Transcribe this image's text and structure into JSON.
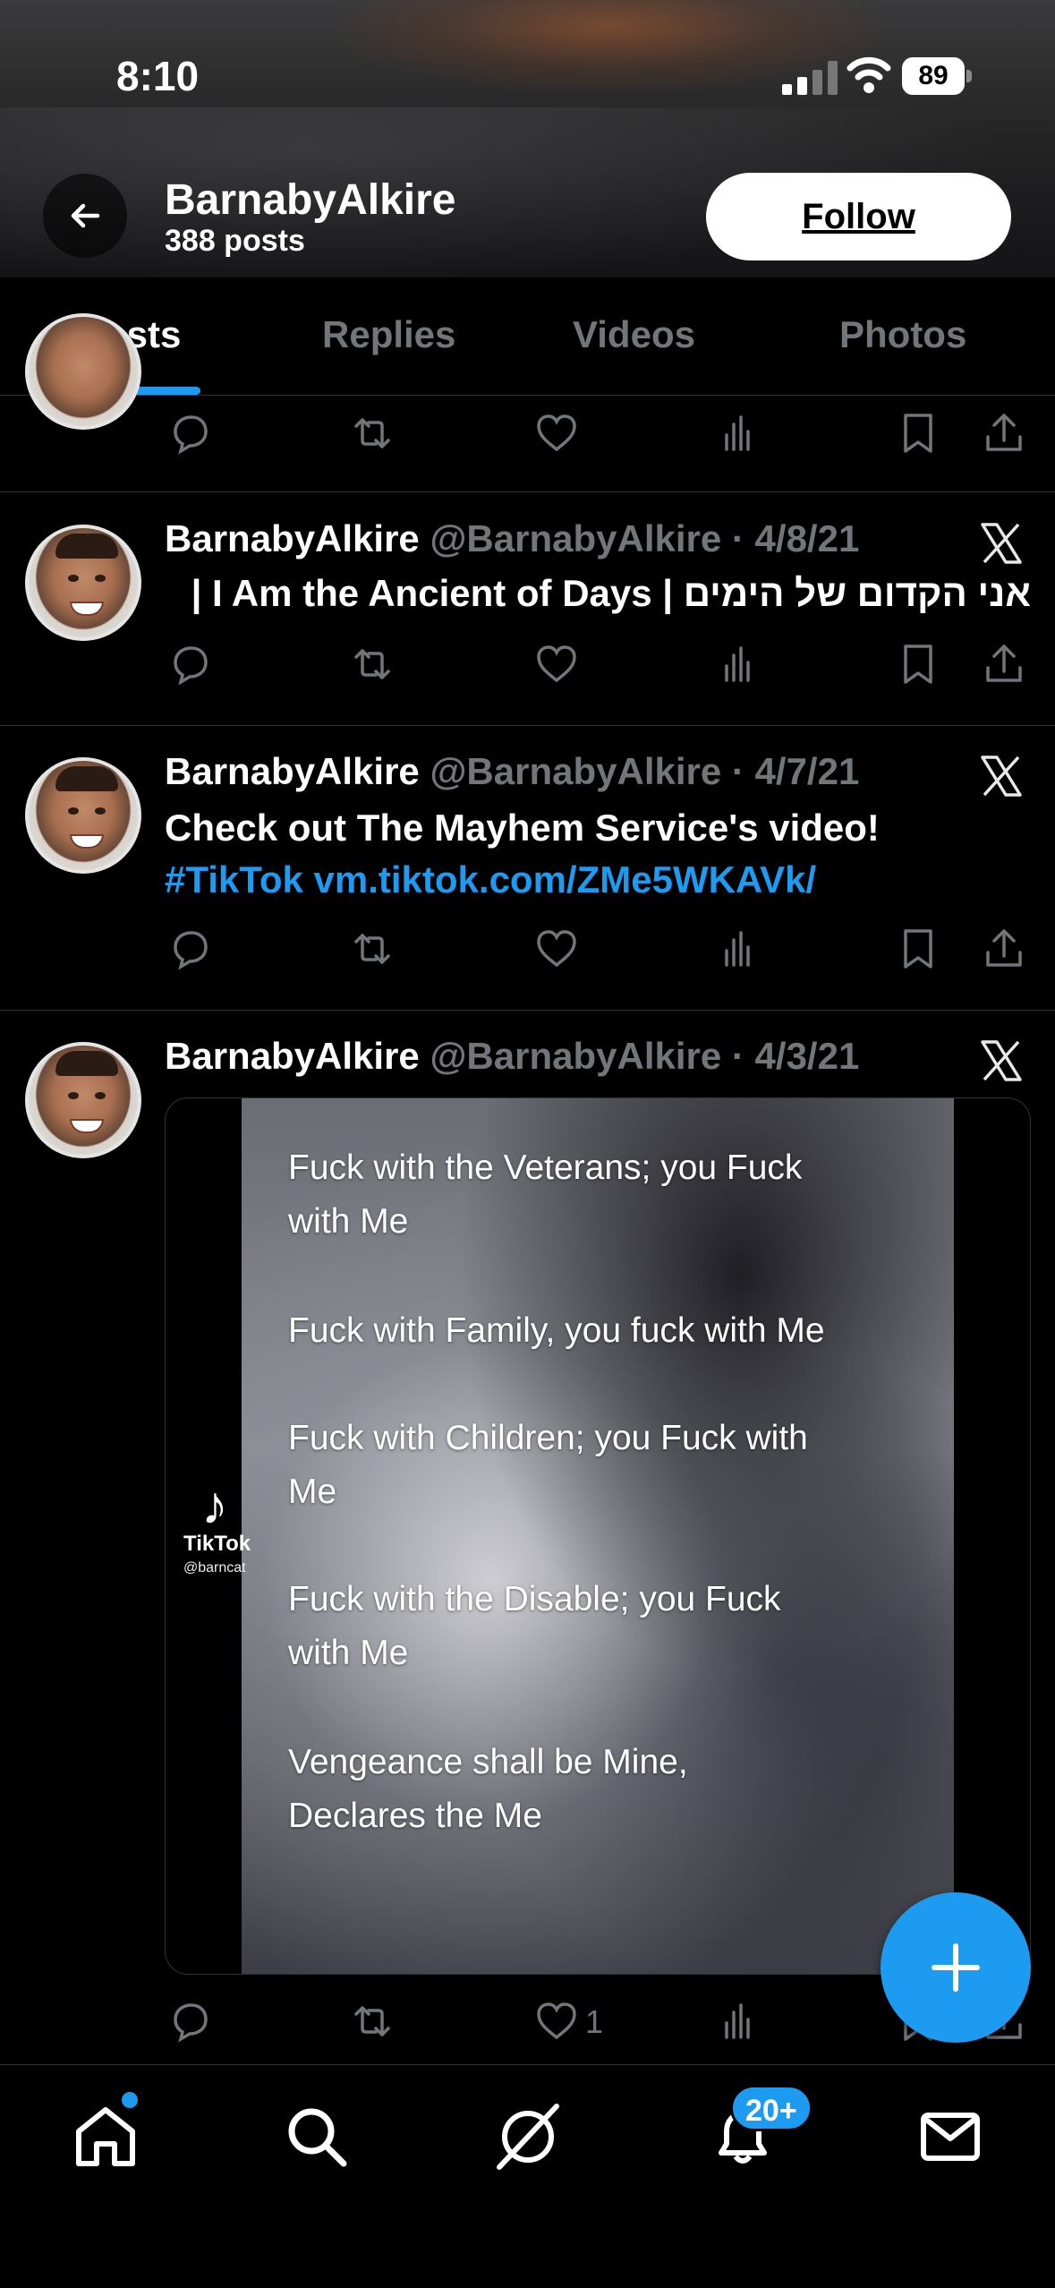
{
  "status_bar": {
    "time": "8:10",
    "battery": "89"
  },
  "header": {
    "name": "BarnabyAlkire",
    "posts_count": "388 posts",
    "follow_label": "Follow"
  },
  "tabs": [
    {
      "label": "Posts",
      "active": true
    },
    {
      "label": "Replies",
      "active": false
    },
    {
      "label": "Videos",
      "active": false
    },
    {
      "label": "Photos",
      "active": false
    }
  ],
  "posts": [
    {
      "name": "BarnabyAlkire",
      "meta": "@BarnabyAlkire · 4/8/21",
      "text": "אני הקדום של הימים | I Am the Ancient of Days |"
    },
    {
      "name": "BarnabyAlkire",
      "meta": "@BarnabyAlkire · 4/7/21",
      "text": "Check out The Mayhem Service's video!",
      "hashtag": "#TikTok",
      "link": "vm.tiktok.com/ZMe5WKAVk/"
    },
    {
      "name": "BarnabyAlkire",
      "meta": "@BarnabyAlkire · 4/3/21",
      "media": {
        "lines": [
          "Fuck with the Veterans; you Fuck",
          "with Me",
          "Fuck with Family, you fuck with Me",
          "Fuck with Children; you Fuck with",
          "Me",
          "Fuck with the Disable; you Fuck",
          "with Me",
          "Vengeance shall be Mine,",
          "Declares the Me"
        ],
        "watermark": "TikTok",
        "watermark_user": "@barncat"
      },
      "like_count": "1"
    }
  ],
  "bottom_nav": {
    "notifications_badge": "20+"
  },
  "colors": {
    "accent": "#1d9bf0",
    "muted": "#71767b",
    "background": "#000000"
  }
}
